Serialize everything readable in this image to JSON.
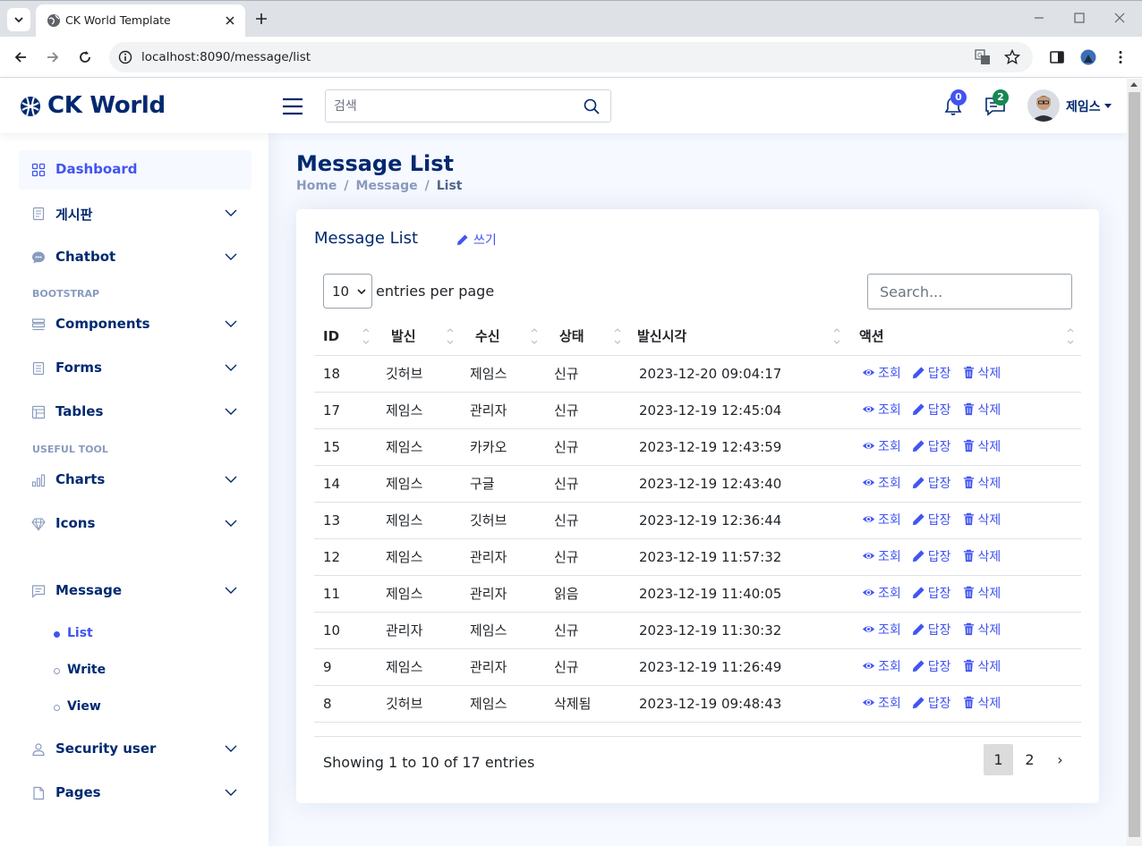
{
  "browser": {
    "tab_title": "CK World Template",
    "url": "localhost:8090/message/list"
  },
  "header": {
    "logo": "CK World",
    "search_placeholder": "검색",
    "notifications_count": "0",
    "messages_count": "2",
    "user_name": "제임스"
  },
  "sidebar": {
    "dashboard": "Dashboard",
    "board": "게시판",
    "chatbot": "Chatbot",
    "heading_bootstrap": "BOOTSTRAP",
    "components": "Components",
    "forms": "Forms",
    "tables": "Tables",
    "heading_useful": "USEFUL TOOL",
    "charts": "Charts",
    "icons": "Icons",
    "message": "Message",
    "message_sub": [
      "List",
      "Write",
      "View"
    ],
    "security_user": "Security user",
    "pages": "Pages"
  },
  "page": {
    "title": "Message List",
    "breadcrumb": [
      "Home",
      "/",
      "Message",
      "/",
      "List"
    ]
  },
  "card": {
    "title": "Message List",
    "write_label": "쓰기",
    "per_page_value": "10",
    "per_page_label": "entries per page",
    "search_placeholder": "Search...",
    "columns": [
      "ID",
      "발신",
      "수신",
      "상태",
      "발신시각",
      "액션"
    ],
    "actions": {
      "view": "조회",
      "reply": "답장",
      "delete": "삭제"
    },
    "rows": [
      {
        "id": "18",
        "from": "깃허브",
        "to": "제임스",
        "status": "신규",
        "time": "2023-12-20 09:04:17"
      },
      {
        "id": "17",
        "from": "제임스",
        "to": "관리자",
        "status": "신규",
        "time": "2023-12-19 12:45:04"
      },
      {
        "id": "15",
        "from": "제임스",
        "to": "카카오",
        "status": "신규",
        "time": "2023-12-19 12:43:59"
      },
      {
        "id": "14",
        "from": "제임스",
        "to": "구글",
        "status": "신규",
        "time": "2023-12-19 12:43:40"
      },
      {
        "id": "13",
        "from": "제임스",
        "to": "깃허브",
        "status": "신규",
        "time": "2023-12-19 12:36:44"
      },
      {
        "id": "12",
        "from": "제임스",
        "to": "관리자",
        "status": "신규",
        "time": "2023-12-19 11:57:32"
      },
      {
        "id": "11",
        "from": "제임스",
        "to": "관리자",
        "status": "읽음",
        "time": "2023-12-19 11:40:05"
      },
      {
        "id": "10",
        "from": "관리자",
        "to": "제임스",
        "status": "신규",
        "time": "2023-12-19 11:30:32"
      },
      {
        "id": "9",
        "from": "제임스",
        "to": "관리자",
        "status": "신규",
        "time": "2023-12-19 11:26:49"
      },
      {
        "id": "8",
        "from": "깃허브",
        "to": "제임스",
        "status": "삭제됨",
        "time": "2023-12-19 09:48:43"
      }
    ],
    "showing": "Showing 1 to 10 of 17 entries",
    "pages": [
      "1",
      "2",
      "›"
    ]
  },
  "colors": {
    "primary": "#4154f1",
    "navy": "#012970",
    "background": "#f6f9ff"
  }
}
